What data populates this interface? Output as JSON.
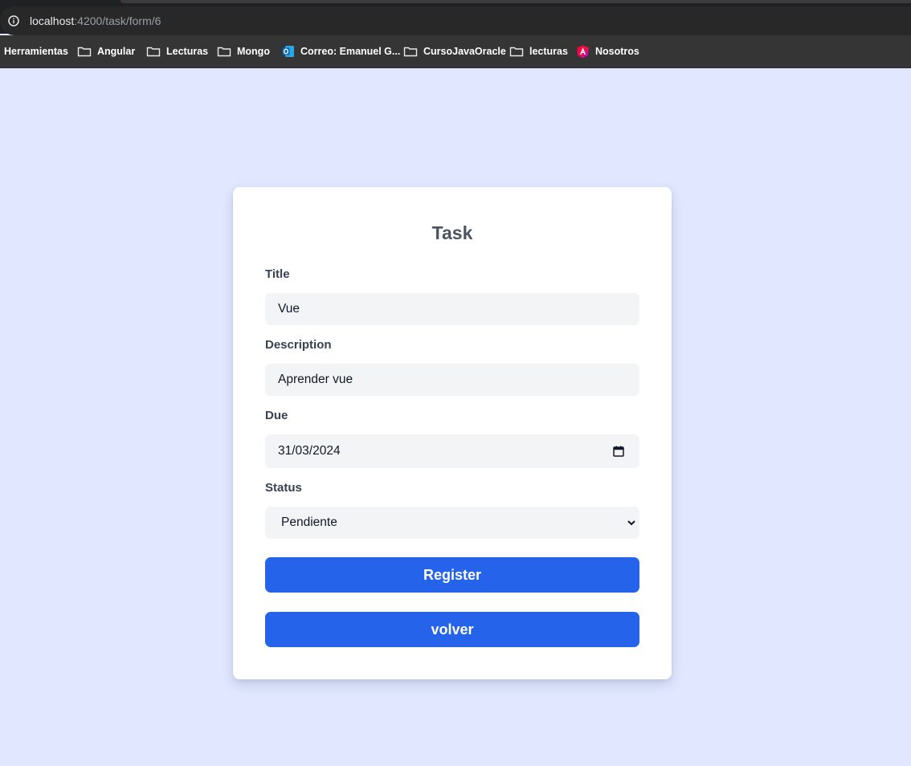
{
  "browser": {
    "url_host": "localhost",
    "url_path": ":4200/task/form/6",
    "bookmarks": [
      {
        "label": "Herramientas",
        "icon": "none"
      },
      {
        "label": "Angular",
        "icon": "folder-icon"
      },
      {
        "label": "Lecturas",
        "icon": "folder-icon"
      },
      {
        "label": "Mongo",
        "icon": "folder-icon"
      },
      {
        "label": "Correo: Emanuel G...",
        "icon": "outlook-icon"
      },
      {
        "label": "CursoJavaOracle",
        "icon": "folder-icon"
      },
      {
        "label": "lecturas",
        "icon": "folder-icon"
      },
      {
        "label": "Nosotros",
        "icon": "angular-logo-icon"
      }
    ]
  },
  "form": {
    "title": "Task",
    "title_label": "Title",
    "title_value": "Vue",
    "description_label": "Description",
    "description_value": "Aprender vue",
    "due_label": "Due",
    "due_value": "31/03/2024",
    "status_label": "Status",
    "status_value": "Pendiente",
    "register_button": "Register",
    "back_button": "volver"
  },
  "colors": {
    "page_background": "#e0e7ff",
    "primary_button": "#2563eb",
    "input_background": "#f3f4f6"
  }
}
